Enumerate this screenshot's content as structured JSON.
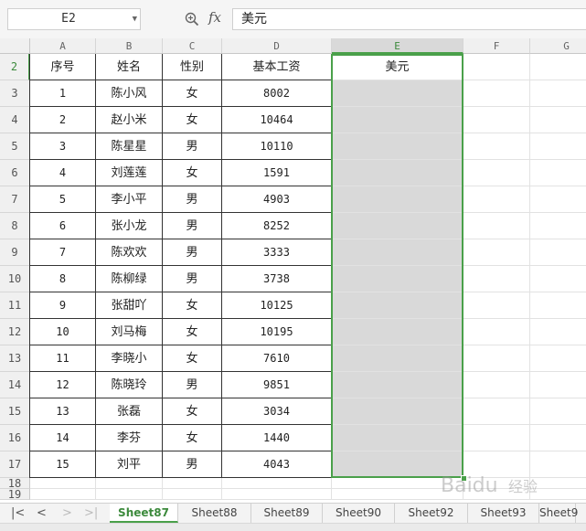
{
  "formula_bar": {
    "name_box": "E2",
    "fx_label": "fx",
    "formula": "美元"
  },
  "columns": [
    "A",
    "B",
    "C",
    "D",
    "E",
    "F",
    "G"
  ],
  "selected_column": "E",
  "row_numbers": [
    "2",
    "3",
    "4",
    "5",
    "6",
    "7",
    "8",
    "9",
    "10",
    "11",
    "12",
    "13",
    "14",
    "15",
    "16",
    "17",
    "18",
    "19"
  ],
  "table": {
    "headers": [
      "序号",
      "姓名",
      "性别",
      "基本工资",
      "美元"
    ],
    "rows": [
      [
        "1",
        "陈小风",
        "女",
        "8002",
        ""
      ],
      [
        "2",
        "赵小米",
        "女",
        "10464",
        ""
      ],
      [
        "3",
        "陈星星",
        "男",
        "10110",
        ""
      ],
      [
        "4",
        "刘莲莲",
        "女",
        "1591",
        ""
      ],
      [
        "5",
        "李小平",
        "男",
        "4903",
        ""
      ],
      [
        "6",
        "张小龙",
        "男",
        "8252",
        ""
      ],
      [
        "7",
        "陈欢欢",
        "男",
        "3333",
        ""
      ],
      [
        "8",
        "陈柳绿",
        "男",
        "3738",
        ""
      ],
      [
        "9",
        "张甜吖",
        "女",
        "10125",
        ""
      ],
      [
        "10",
        "刘马梅",
        "女",
        "10195",
        ""
      ],
      [
        "11",
        "李晓小",
        "女",
        "7610",
        ""
      ],
      [
        "12",
        "陈晓玲",
        "男",
        "9851",
        ""
      ],
      [
        "13",
        "张磊",
        "女",
        "3034",
        ""
      ],
      [
        "14",
        "李芬",
        "女",
        "1440",
        ""
      ],
      [
        "15",
        "刘平",
        "男",
        "4043",
        ""
      ]
    ]
  },
  "sheet_tabs": [
    "Sheet87",
    "Sheet88",
    "Sheet89",
    "Sheet90",
    "Sheet92",
    "Sheet93",
    "Sheet9"
  ],
  "active_sheet": "Sheet87",
  "colors": {
    "accent": "#4aa04a",
    "selection_fill": "#d9d9d9"
  },
  "icons": [
    "zoom-icon",
    "first-sheet-icon",
    "prev-sheet-icon",
    "next-sheet-icon",
    "last-sheet-icon"
  ]
}
